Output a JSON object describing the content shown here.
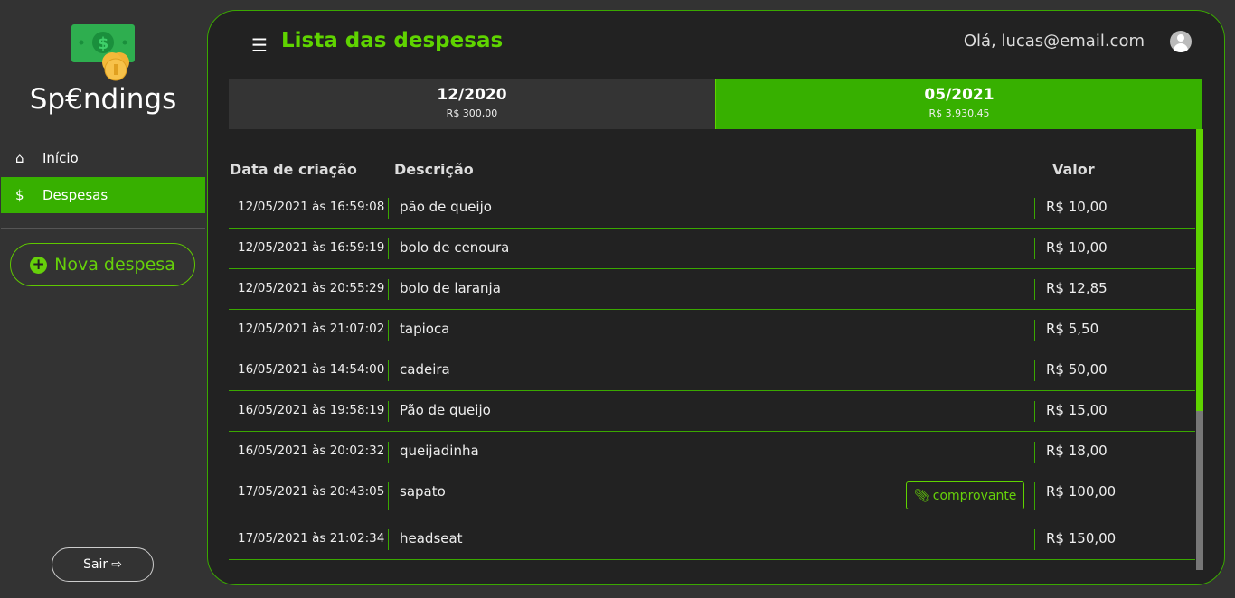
{
  "sidebar": {
    "brand": "Sp€ndings",
    "items": [
      {
        "label": "Início",
        "icon": "home-icon"
      },
      {
        "label": "Despesas",
        "icon": "hand-dollar-icon",
        "active": true
      }
    ],
    "new_expense": "Nova despesa",
    "logout": "Sair"
  },
  "header": {
    "title": "Lista das despesas",
    "greeting": "Olá, lucas@email.com"
  },
  "months": [
    {
      "month": "12/2020",
      "total": "R$ 300,00"
    },
    {
      "month": "05/2021",
      "total": "R$ 3.930,45",
      "active": true
    }
  ],
  "table": {
    "headers": {
      "date": "Data de criação",
      "description": "Descrição",
      "value": "Valor"
    },
    "attachment_label": "comprovante",
    "rows": [
      {
        "date": "12/05/2021 às 16:59:08",
        "description": "pão de queijo",
        "value": "R$ 10,00"
      },
      {
        "date": "12/05/2021 às 16:59:19",
        "description": "bolo de cenoura",
        "value": "R$ 10,00"
      },
      {
        "date": "12/05/2021 às 20:55:29",
        "description": "bolo de laranja",
        "value": "R$ 12,85"
      },
      {
        "date": "12/05/2021 às 21:07:02",
        "description": "tapioca",
        "value": "R$ 5,50"
      },
      {
        "date": "16/05/2021 às 14:54:00",
        "description": "cadeira",
        "value": "R$ 50,00"
      },
      {
        "date": "16/05/2021 às 19:58:19",
        "description": "Pão de queijo",
        "value": "R$ 15,00"
      },
      {
        "date": "16/05/2021 às 20:02:32",
        "description": "queijadinha",
        "value": "R$ 18,00"
      },
      {
        "date": "17/05/2021 às 20:43:05",
        "description": "sapato",
        "value": "R$ 100,00",
        "attachment": true
      },
      {
        "date": "17/05/2021 às 21:02:34",
        "description": "headseat",
        "value": "R$ 150,00"
      }
    ]
  },
  "colors": {
    "accent": "#37b000",
    "accent_text": "#5fd400",
    "card_bg": "#222222",
    "page_bg": "#333333"
  }
}
